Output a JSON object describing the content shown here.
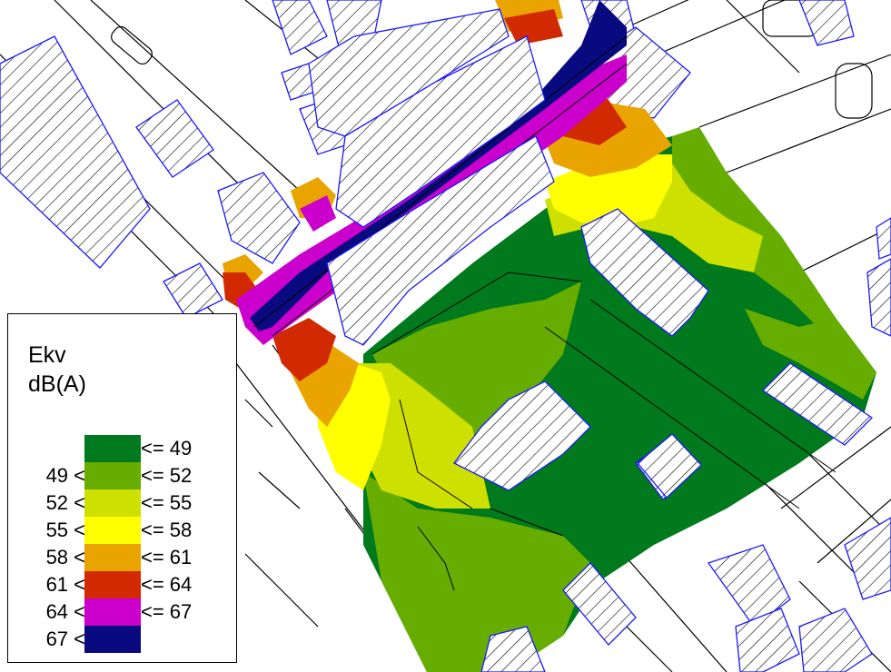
{
  "legend": {
    "title": "Ekv",
    "unit": "dB(A)",
    "classes": [
      {
        "lower": "",
        "upper": "<= 49",
        "color": "#007a1c"
      },
      {
        "lower": "49 <",
        "upper": "<= 52",
        "color": "#66ad00"
      },
      {
        "lower": "52 <",
        "upper": "<= 55",
        "color": "#cde000"
      },
      {
        "lower": "55 <",
        "upper": "<= 58",
        "color": "#ffff00"
      },
      {
        "lower": "58 <",
        "upper": "<= 61",
        "color": "#e9a400"
      },
      {
        "lower": "61 <",
        "upper": "<= 64",
        "color": "#d22a00"
      },
      {
        "lower": "64 <",
        "upper": "<= 67",
        "color": "#cc00cc"
      },
      {
        "lower": "67 <",
        "upper": "",
        "color": "#0a0a80"
      }
    ]
  }
}
